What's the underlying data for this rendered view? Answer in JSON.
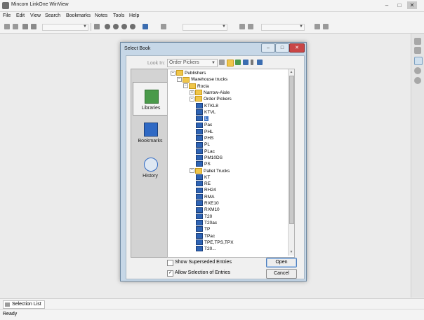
{
  "window": {
    "title": "Mincom LinkOne WinView",
    "minimize": "–",
    "maximize": "□",
    "close": "✕"
  },
  "menu": [
    "File",
    "Edit",
    "View",
    "Search",
    "Bookmarks",
    "Notes",
    "Tools",
    "Help"
  ],
  "dialog": {
    "title": "Select Book",
    "buttons": {
      "minimize": "–",
      "maximize": "□",
      "close": "✕"
    },
    "nav": [
      {
        "label": "Libraries",
        "icon": "books-icon",
        "selected": true
      },
      {
        "label": "Bookmarks",
        "icon": "flag-icon",
        "selected": false
      },
      {
        "label": "History",
        "icon": "stopwatch-icon",
        "selected": false
      }
    ],
    "look_in_label": "Look In:",
    "look_in_value": "Order Pickers",
    "tree": [
      {
        "level": 0,
        "type": "folder",
        "toggle": "−",
        "label": "Publishers"
      },
      {
        "level": 1,
        "type": "folder",
        "toggle": "−",
        "label": "Warehouse trucks"
      },
      {
        "level": 2,
        "type": "folder",
        "toggle": "−",
        "label": "Rocla"
      },
      {
        "level": 3,
        "type": "folder",
        "toggle": "+",
        "label": "Narrow-Aisle"
      },
      {
        "level": 3,
        "type": "folder",
        "toggle": "−",
        "label": "Order Pickers"
      },
      {
        "level": 4,
        "type": "book",
        "label": "KTKL8"
      },
      {
        "level": 4,
        "type": "book",
        "label": "KTVL"
      },
      {
        "level": 4,
        "type": "book",
        "label": "L",
        "selected": true
      },
      {
        "level": 4,
        "type": "book",
        "label": "Pac"
      },
      {
        "level": 4,
        "type": "book",
        "label": "PHL"
      },
      {
        "level": 4,
        "type": "book",
        "label": "PHS"
      },
      {
        "level": 4,
        "type": "book",
        "label": "PL"
      },
      {
        "level": 4,
        "type": "book",
        "label": "PLac"
      },
      {
        "level": 4,
        "type": "book",
        "label": "PM10DS"
      },
      {
        "level": 4,
        "type": "book",
        "label": "PS"
      },
      {
        "level": 3,
        "type": "folder",
        "toggle": "−",
        "label": "Pallet Trucks"
      },
      {
        "level": 4,
        "type": "book",
        "label": "KT"
      },
      {
        "level": 4,
        "type": "book",
        "label": "RE"
      },
      {
        "level": 4,
        "type": "book",
        "label": "RH24"
      },
      {
        "level": 4,
        "type": "book",
        "label": "RMA"
      },
      {
        "level": 4,
        "type": "book",
        "label": "RXE10"
      },
      {
        "level": 4,
        "type": "book",
        "label": "RXM10"
      },
      {
        "level": 4,
        "type": "book",
        "label": "T20"
      },
      {
        "level": 4,
        "type": "book",
        "label": "T20ac"
      },
      {
        "level": 4,
        "type": "book",
        "label": "TP"
      },
      {
        "level": 4,
        "type": "book",
        "label": "TPac"
      },
      {
        "level": 4,
        "type": "book",
        "label": "TPE,TPS,TPX"
      },
      {
        "level": 4,
        "type": "book",
        "label": "T20..."
      }
    ],
    "show_superseded": {
      "label": "Show Superseded Entries",
      "checked": false
    },
    "allow_selection": {
      "label": "Allow Selection of Entries",
      "checked": true
    },
    "open_label": "Open",
    "cancel_label": "Cancel"
  },
  "bottom_tab": "Selection List",
  "status": "Ready"
}
